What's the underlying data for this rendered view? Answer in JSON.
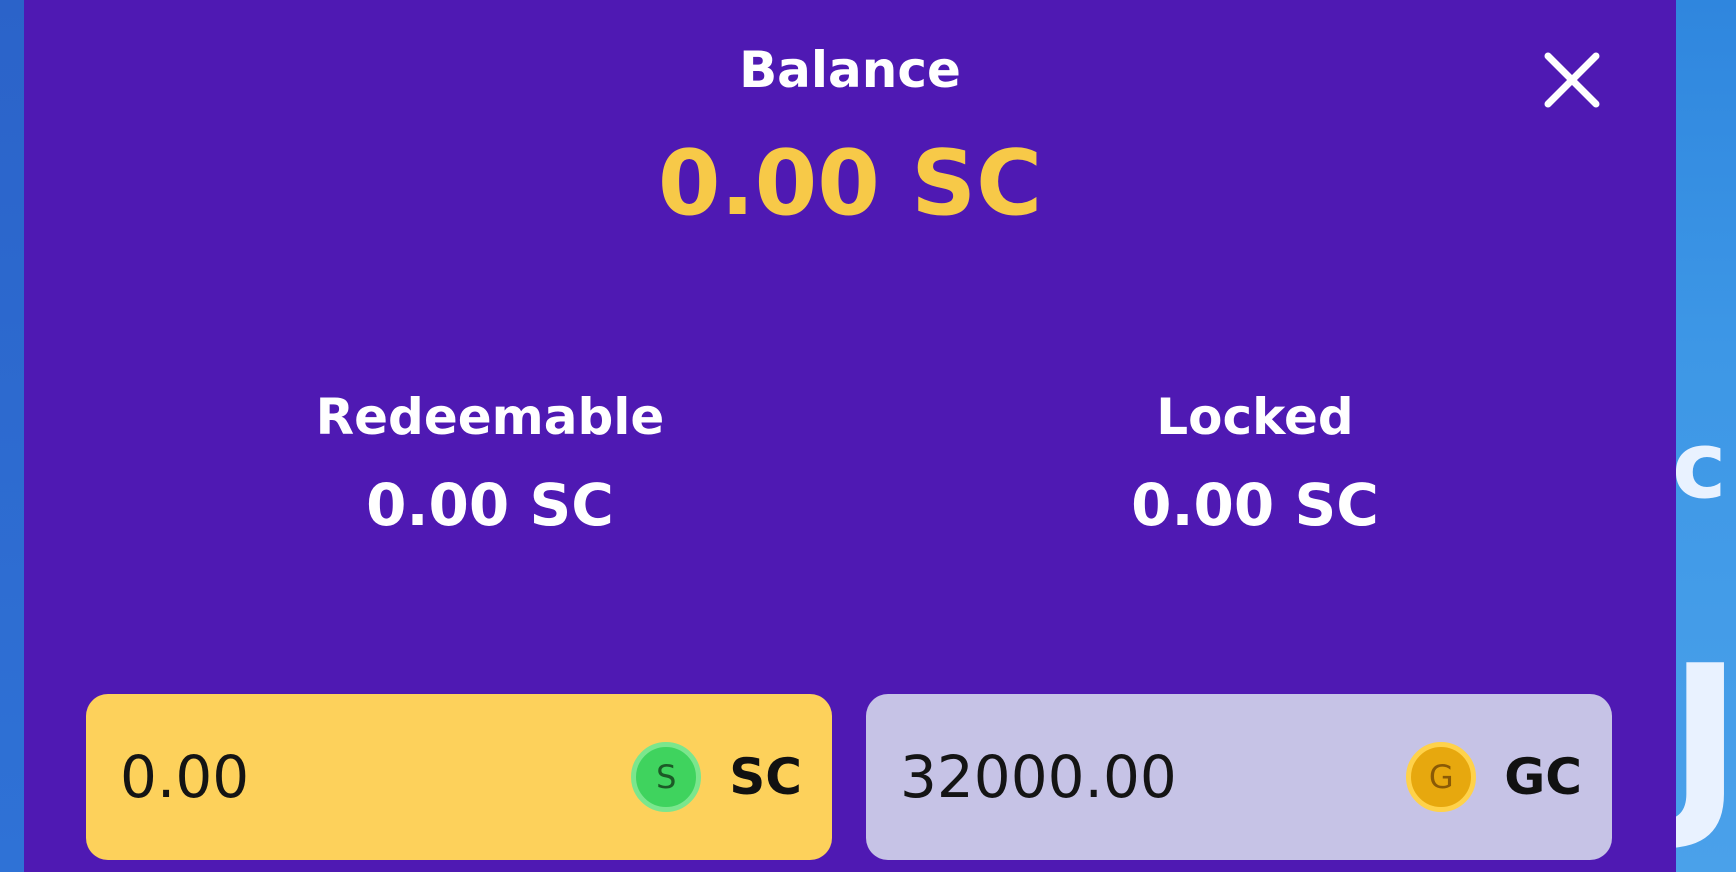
{
  "modal": {
    "title": "Balance",
    "balance_value": "0.00 SC",
    "close_icon": "close-icon"
  },
  "stats": {
    "redeemable": {
      "label": "Redeemable",
      "value": "0.00 SC"
    },
    "locked": {
      "label": "Locked",
      "value": "0.00 SC"
    }
  },
  "wallets": {
    "sweeps": {
      "value": "0.00",
      "coin_letter": "S",
      "currency": "SC",
      "color": "#fdd15b",
      "coin_color": "#3fd35e"
    },
    "gold": {
      "value": "32000.00",
      "coin_letter": "G",
      "currency": "GC",
      "color": "#c6c3e6",
      "coin_color": "#e7a80e"
    }
  },
  "background": {
    "fragment_1": "c",
    "fragment_2": "J"
  },
  "colors": {
    "modal_bg": "#4f19b3",
    "accent_gold": "#f7c948"
  }
}
